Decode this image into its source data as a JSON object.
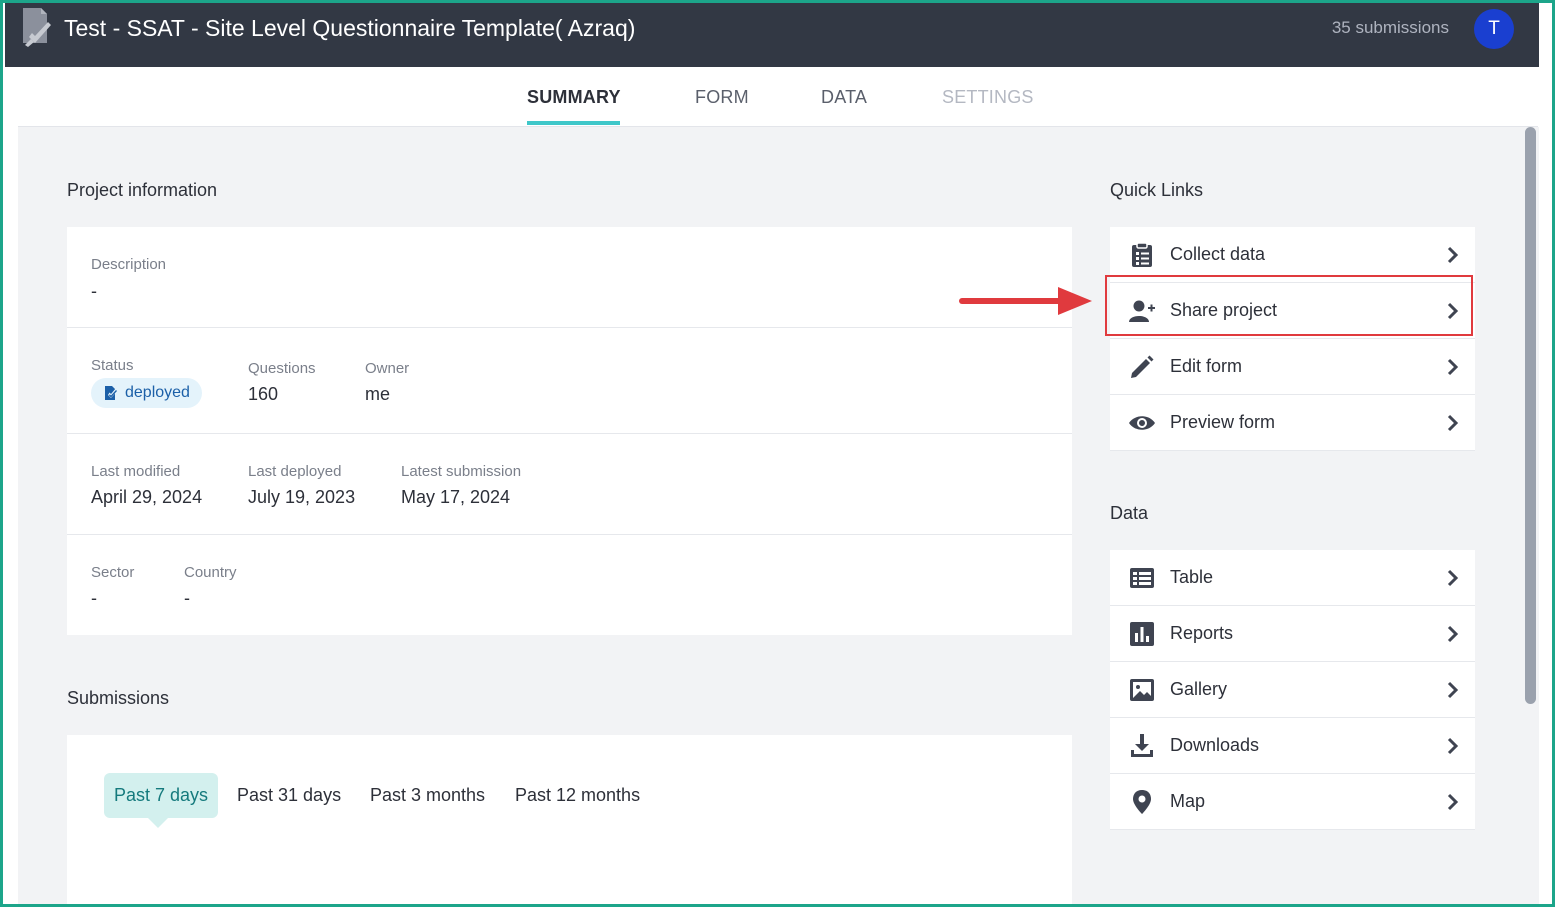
{
  "header": {
    "title": "Test - SSAT - Site Level Questionnaire Template( Azraq)",
    "submissions": "35 submissions",
    "avatar_letter": "T"
  },
  "tabs": [
    {
      "label": "SUMMARY",
      "state": "active"
    },
    {
      "label": "FORM",
      "state": "normal"
    },
    {
      "label": "DATA",
      "state": "normal"
    },
    {
      "label": "SETTINGS",
      "state": "disabled"
    }
  ],
  "project_info": {
    "section_title": "Project information",
    "description_label": "Description",
    "description_value": "-",
    "status_label": "Status",
    "status_value": "deployed",
    "questions_label": "Questions",
    "questions_value": "160",
    "owner_label": "Owner",
    "owner_value": "me",
    "last_modified_label": "Last modified",
    "last_modified_value": "April 29, 2024",
    "last_deployed_label": "Last deployed",
    "last_deployed_value": "July 19, 2023",
    "latest_submission_label": "Latest submission",
    "latest_submission_value": "May 17, 2024",
    "sector_label": "Sector",
    "sector_value": "-",
    "country_label": "Country",
    "country_value": "-"
  },
  "quick_links": {
    "section_title": "Quick Links",
    "items": [
      {
        "label": "Collect data",
        "icon": "clipboard-list-icon"
      },
      {
        "label": "Share project",
        "icon": "user-plus-icon"
      },
      {
        "label": "Edit form",
        "icon": "pencil-icon"
      },
      {
        "label": "Preview form",
        "icon": "eye-icon"
      }
    ]
  },
  "data_links": {
    "section_title": "Data",
    "items": [
      {
        "label": "Table",
        "icon": "table-icon"
      },
      {
        "label": "Reports",
        "icon": "bar-chart-icon"
      },
      {
        "label": "Gallery",
        "icon": "image-icon"
      },
      {
        "label": "Downloads",
        "icon": "download-icon"
      },
      {
        "label": "Map",
        "icon": "map-pin-icon"
      }
    ]
  },
  "submissions": {
    "section_title": "Submissions",
    "ranges": [
      "Past 7 days",
      "Past 31 days",
      "Past 3 months",
      "Past 12 months"
    ],
    "active_range": "Past 7 days"
  },
  "colors": {
    "header_bg": "#323844",
    "accent_teal": "#3fc7c9",
    "avatar_blue": "#1a3fd0",
    "highlight_red": "#e03a3e",
    "frame_green": "#1ca58a"
  }
}
